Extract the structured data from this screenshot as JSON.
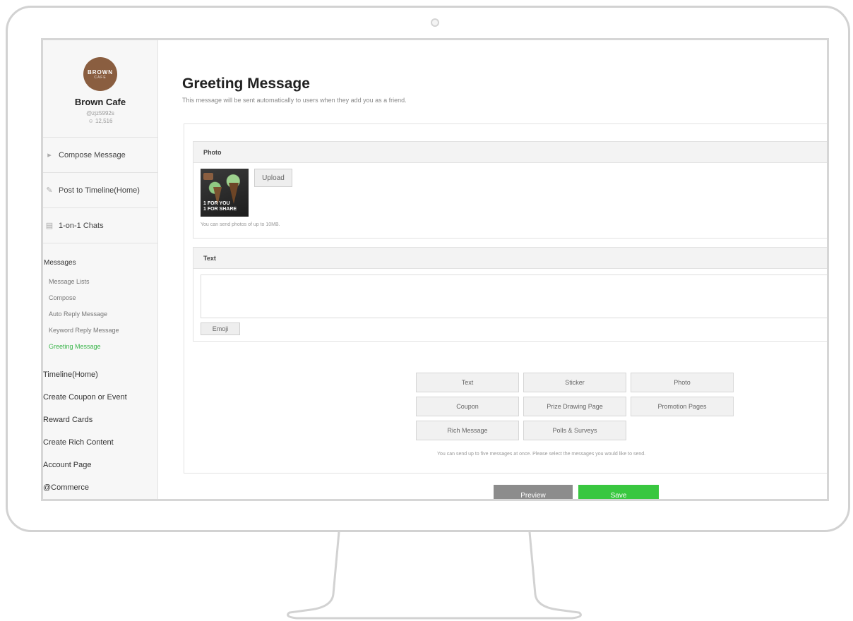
{
  "sidebar": {
    "logo_main": "BROWN",
    "logo_sub": "CAFE",
    "account_name": "Brown Cafe",
    "account_id": "@zjz5992s",
    "friends": "12,516",
    "main_nav": [
      {
        "label": "Compose Message",
        "icon": "speaker-icon"
      },
      {
        "label": "Post to Timeline(Home)",
        "icon": "pencil-icon"
      },
      {
        "label": "1-on-1 Chats",
        "icon": "chat-icon"
      }
    ],
    "messages_section": "Messages",
    "message_items": [
      "Message Lists",
      "Compose",
      "Auto Reply Message",
      "Keyword Reply Message",
      "Greeting Message"
    ],
    "active_item": "Greeting Message",
    "other_sections": [
      "Timeline(Home)",
      "Create Coupon or Event",
      "Reward Cards",
      "Create Rich Content",
      "Account Page",
      "@Commerce"
    ]
  },
  "main": {
    "title": "Greeting Message",
    "description": "This message will be sent automatically to users when they add you as a friend.",
    "photo_panel": {
      "header": "Photo",
      "thumbnail_text_line1": "1 FOR YOU",
      "thumbnail_text_line2": "1 FOR SHARE",
      "upload_label": "Upload",
      "note": "You can send photos of up to 10MB."
    },
    "text_panel": {
      "header": "Text",
      "emoji_label": "Emoji"
    },
    "message_types": [
      "Text",
      "Sticker",
      "Photo",
      "Coupon",
      "Prize Drawing Page",
      "Promotion Pages",
      "Rich Message",
      "Polls & Surveys"
    ],
    "message_types_note": "You can send up to five messages at once. Please select the messages you would like to send.",
    "preview_label": "Preview",
    "save_label": "Save"
  },
  "colors": {
    "accent_green": "#39c740",
    "active_link": "#39b54a",
    "logo_brown": "#8a5e40"
  }
}
